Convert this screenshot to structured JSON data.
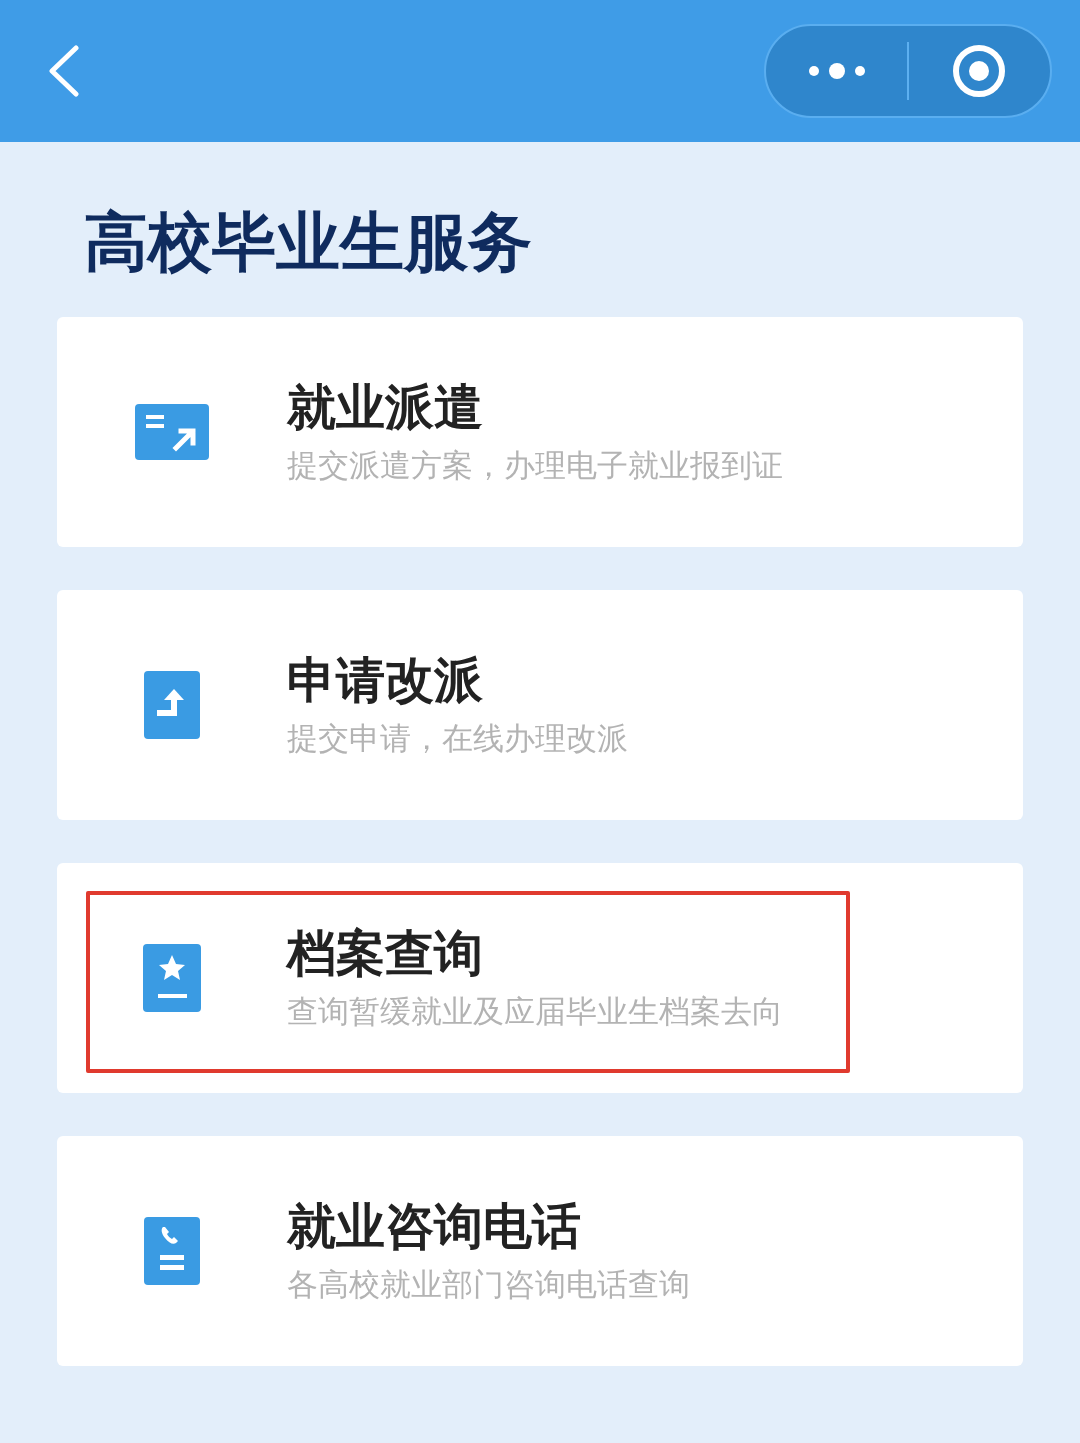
{
  "page_title": "高校毕业生服务",
  "services": [
    {
      "kind": "dispatch",
      "title": "就业派遣",
      "description": "提交派遣方案，办理电子就业报到证",
      "highlighted": false
    },
    {
      "kind": "reassign",
      "title": "申请改派",
      "description": "提交申请，在线办理改派",
      "highlighted": false
    },
    {
      "kind": "archive",
      "title": "档案查询",
      "description": "查询暂缓就业及应届毕业生档案去向",
      "highlighted": true
    },
    {
      "kind": "phone",
      "title": "就业咨询电话",
      "description": "各高校就业部门咨询电话查询",
      "highlighted": false
    }
  ]
}
